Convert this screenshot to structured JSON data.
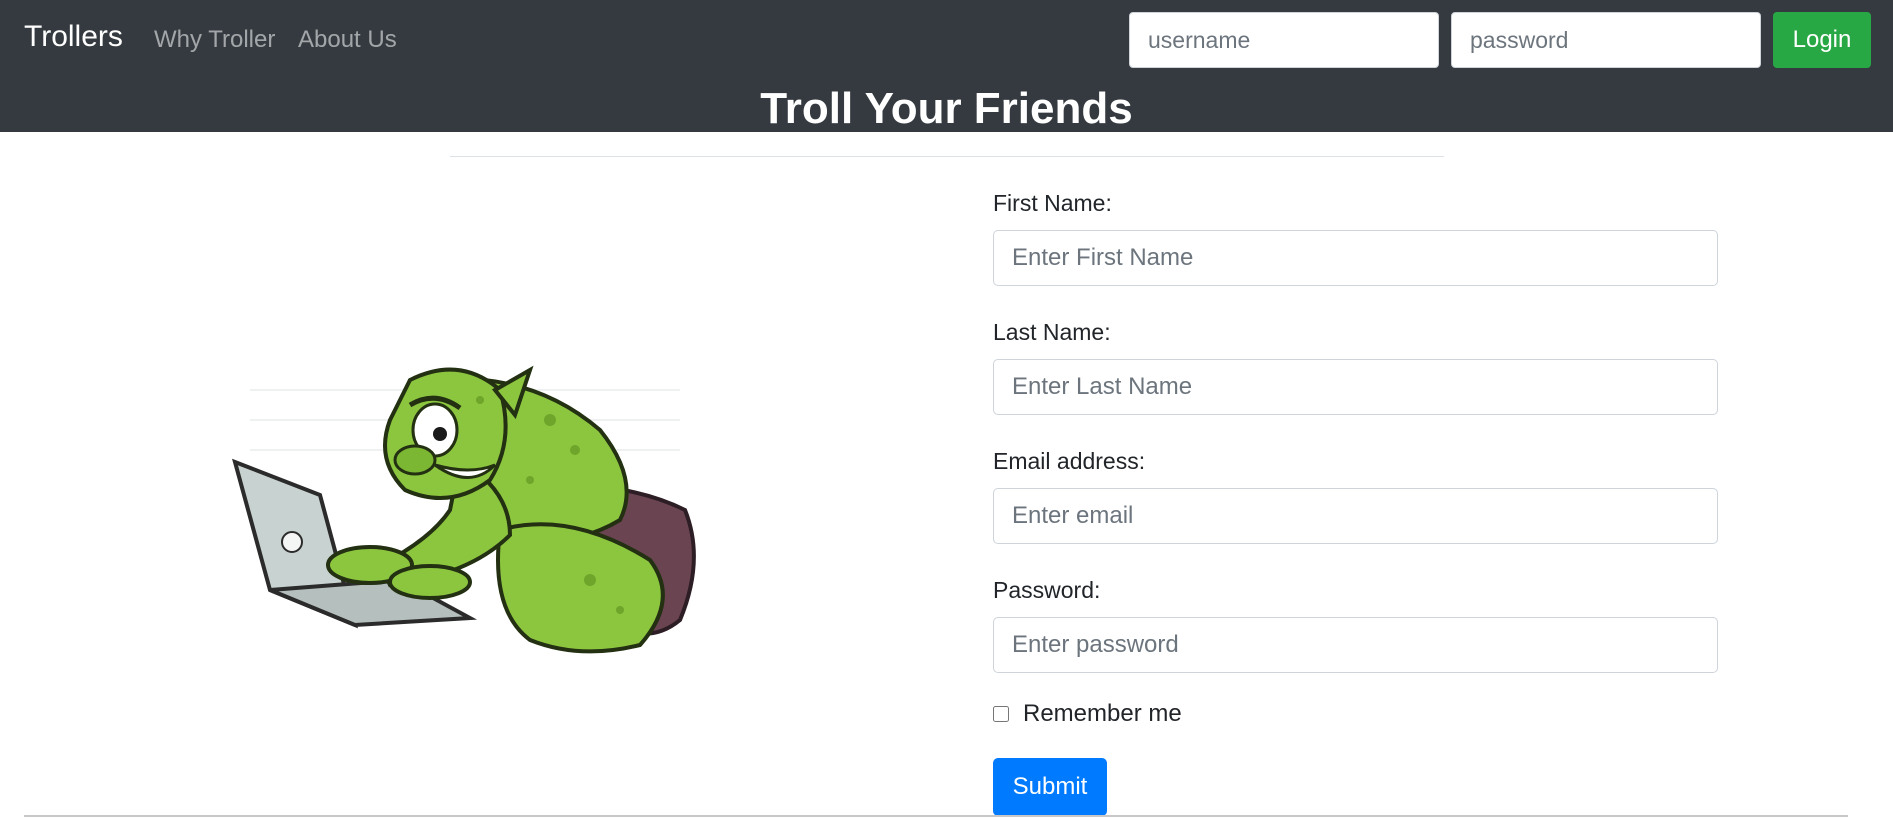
{
  "nav": {
    "brand": "Trollers",
    "links": [
      "Why Troller",
      "About Us"
    ],
    "username_placeholder": "username",
    "password_placeholder": "password",
    "login_label": "Login"
  },
  "hero": {
    "title": "Troll Your Friends"
  },
  "image": {
    "icon": "troll-typing-on-laptop-illustration",
    "colors": {
      "skin": "#8cc63f",
      "skin_dark": "#6ea52a",
      "shorts": "#6b4452",
      "laptop": "#c8d2d0"
    }
  },
  "form": {
    "first_name_label": "First Name:",
    "first_name_placeholder": "Enter First Name",
    "last_name_label": "Last Name:",
    "last_name_placeholder": "Enter Last Name",
    "email_label": "Email address:",
    "email_placeholder": "Enter email",
    "password_label": "Password:",
    "password_placeholder": "Enter password",
    "remember_label": "Remember me",
    "submit_label": "Submit"
  },
  "colors": {
    "navbar": "#343a40",
    "login": "#28a745",
    "submit": "#007bff"
  }
}
